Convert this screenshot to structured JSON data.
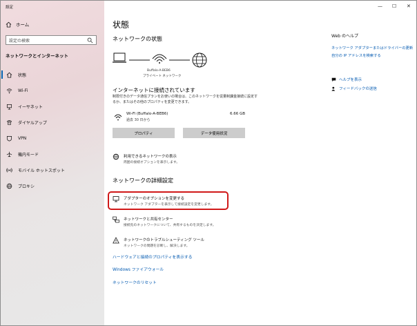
{
  "window": {
    "title": "設定",
    "controls": [
      "—",
      "☐",
      "✕"
    ]
  },
  "sidebar": {
    "home_label": "ホーム",
    "search_placeholder": "設定の検索",
    "section_title": "ネットワークとインターネット",
    "items": [
      {
        "label": "状態",
        "icon": "home-status-icon",
        "active": true
      },
      {
        "label": "Wi-Fi",
        "icon": "wifi-icon"
      },
      {
        "label": "イーサネット",
        "icon": "ethernet-icon"
      },
      {
        "label": "ダイヤルアップ",
        "icon": "dialup-icon"
      },
      {
        "label": "VPN",
        "icon": "vpn-icon"
      },
      {
        "label": "機内モード",
        "icon": "airplane-icon"
      },
      {
        "label": "モバイル ホットスポット",
        "icon": "hotspot-icon"
      },
      {
        "label": "プロキシ",
        "icon": "globe-icon"
      }
    ]
  },
  "main": {
    "title": "状態",
    "network_status_heading": "ネットワークの状態",
    "network_name": "Buffalo-A-BEB6",
    "network_type": "プライベート ネットワーク",
    "connected_title": "インターネットに接続されています",
    "connected_desc": "制限付きのデータ通信プランをお使いの場合は、このネットワークを従量制課金接続に設定するか、またはその他のプロパティを変更できます。",
    "wifi_name": "Wi-Fi (Buffalo-A-BEB6)",
    "wifi_usage": "過去 30 日から",
    "wifi_size": "6.66 GB",
    "buttons": {
      "properties": "プロパティ",
      "data_usage": "データ使用状況"
    },
    "available_networks": {
      "title": "利用できるネットワークの表示",
      "sub": "周囲の接続オプションを表示します。"
    },
    "advanced_heading": "ネットワークの詳細設定",
    "adapter_options": {
      "title": "アダプターのオプションを変更する",
      "sub": "ネットワーク アダプターを表示して接続設定を変更します。"
    },
    "sharing_center": {
      "title": "ネットワークと共有センター",
      "sub": "接続先のネットワークについて、共有するものを決定します。"
    },
    "troubleshoot": {
      "title": "ネットワークのトラブルシューティング ツール",
      "sub": "ネットワークの問題を診断し、解決します。"
    },
    "links": {
      "hardware": "ハードウェアと接続のプロパティを表示する",
      "firewall": "Windows ファイアウォール",
      "reset": "ネットワークのリセット"
    }
  },
  "right": {
    "web_help": "Web のヘルプ",
    "help_links": [
      "ネットワーク アダプターまたはドライバーの更新",
      "自分の IP アドレスを検索する"
    ],
    "get_help": "ヘルプを表示",
    "feedback": "フィードバックの送信"
  }
}
